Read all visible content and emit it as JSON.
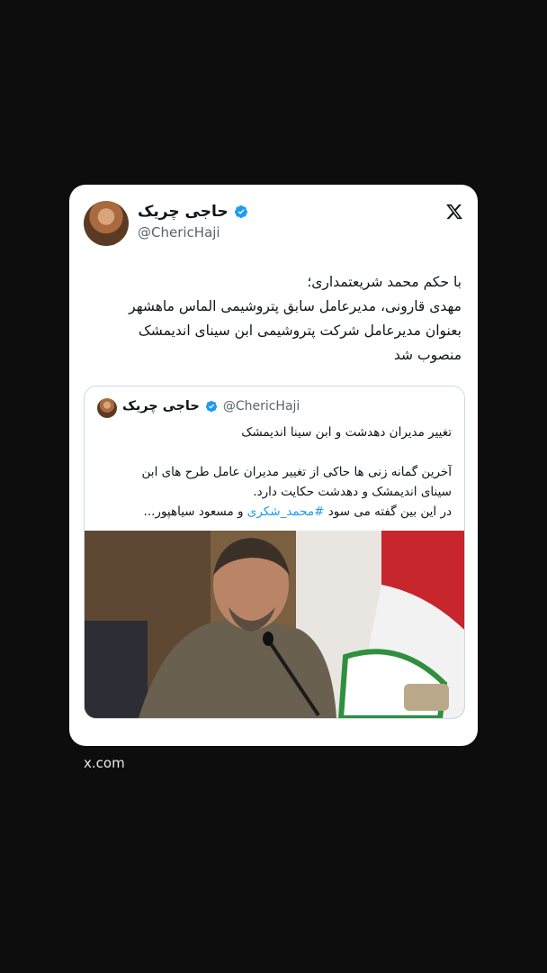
{
  "tweet": {
    "author_name": "حاجی چریک",
    "author_handle": "@ChericHaji",
    "lines": [
      "با حکم محمد شریعتمداری؛",
      "مهدی قارونی، مدیرعامل سابق پتروشیمی الماس ماهشهر",
      "بعنوان مدیرعامل شرکت پتروشیمی ابن سینای اندیمشک",
      "منصوب شد"
    ]
  },
  "quote": {
    "author_name": "حاجی چریک",
    "author_handle": "@ChericHaji",
    "title": "تغییر مدیران دهدشت و ابن سینا اندیمشک",
    "body_line1": "آخرین گمانه زنی ها حاکی از تغییر مدیران عامل طرح های ابن",
    "body_line2": "سینای اندیمشک و دهدشت حکایت دارد.",
    "body_line3_prefix": "در این بین گفته می سود ",
    "body_line3_hashtag": "#محمد_شکری",
    "body_line3_suffix": " و مسعود سیاهپور..."
  },
  "footer": {
    "source": "x.com"
  },
  "colors": {
    "background": "#0d0d0d",
    "card": "#ffffff",
    "verified": "#1d9bf0",
    "hashtag": "#1d9bf0",
    "text": "#0f1419",
    "muted": "#536471"
  },
  "icons": [
    "verified-badge-icon",
    "x-logo-icon"
  ]
}
